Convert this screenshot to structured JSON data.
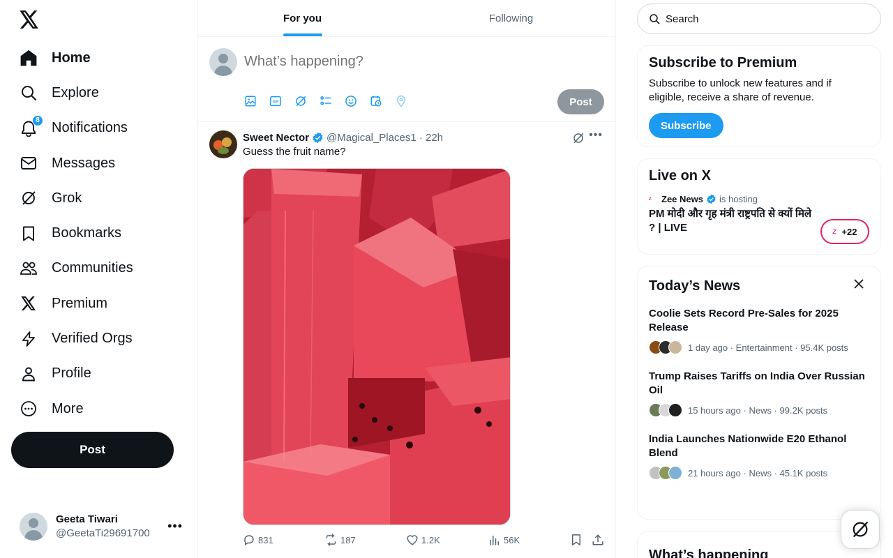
{
  "nav": {
    "items": [
      {
        "label": "Home",
        "icon": "home-icon"
      },
      {
        "label": "Explore",
        "icon": "search-icon"
      },
      {
        "label": "Notifications",
        "icon": "bell-icon",
        "badge": "8"
      },
      {
        "label": "Messages",
        "icon": "envelope-icon"
      },
      {
        "label": "Grok",
        "icon": "grok-icon"
      },
      {
        "label": "Bookmarks",
        "icon": "bookmark-icon"
      },
      {
        "label": "Communities",
        "icon": "people-icon"
      },
      {
        "label": "Premium",
        "icon": "x-logo-icon"
      },
      {
        "label": "Verified Orgs",
        "icon": "lightning-icon"
      },
      {
        "label": "Profile",
        "icon": "person-icon"
      },
      {
        "label": "More",
        "icon": "more-circle-icon"
      }
    ],
    "post_label": "Post"
  },
  "account": {
    "name": "Geeta Tiwari",
    "handle": "@GeetaTi29691700"
  },
  "tabs": [
    {
      "label": "For you"
    },
    {
      "label": "Following"
    }
  ],
  "composer": {
    "placeholder": "What’s happening?",
    "post_label": "Post"
  },
  "tweet": {
    "name": "Sweet Nector",
    "meta": "@Magical_Places1 · 22h",
    "text": "Guess the fruit name?",
    "replies": "831",
    "reposts": "187",
    "likes": "1.2K",
    "views": "56K"
  },
  "search": {
    "placeholder": "Search"
  },
  "premium": {
    "title": "Subscribe to Premium",
    "text": "Subscribe to unlock new features and if eligible, receive a share of revenue.",
    "button": "Subscribe"
  },
  "live": {
    "title": "Live on X",
    "host": "Zee News",
    "hosting": "is hosting",
    "stream_title": "PM मोदी और गृह मंत्री राष्ट्रपति से क्यों मिले ? | LIVE",
    "count": "+22"
  },
  "news": {
    "title": "Today’s News",
    "items": [
      {
        "headline": "Coolie Sets Record Pre-Sales for 2025 Release",
        "meta": "1 day ago · Entertainment · 95.4K posts"
      },
      {
        "headline": "Trump Raises Tariffs on India Over Russian Oil",
        "meta": "15 hours ago · News · 99.2K posts"
      },
      {
        "headline": "India Launches Nationwide E20 Ethanol Blend",
        "meta": "21 hours ago · News · 45.1K posts"
      }
    ]
  },
  "whats_happening": {
    "title": "What’s happening"
  },
  "colors": {
    "accent": "#1d9bf0",
    "text": "#0f1419",
    "muted": "#536471",
    "live_pink": "#e0245e"
  }
}
